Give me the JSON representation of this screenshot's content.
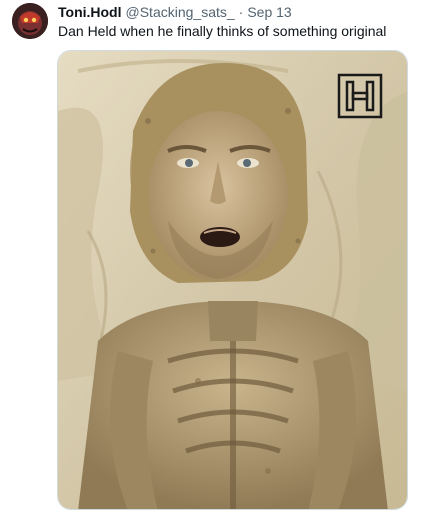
{
  "tweet": {
    "author": {
      "display_name": "Toni.Hodl",
      "handle": "@Stacking_sats_",
      "separator": "·",
      "date": "Sep 13",
      "avatar_icon": "avatar-image"
    },
    "text": "Dan Held when he finally thinks of something original",
    "media": {
      "description_icon": "mummy-meme-image",
      "watermark_icon": "h-logo-icon"
    }
  },
  "colors": {
    "text_primary": "#0f1419",
    "text_secondary": "#536471",
    "border": "#cfd9de",
    "fabric": "#d9cfb4",
    "mummy": "#b9a57f"
  }
}
